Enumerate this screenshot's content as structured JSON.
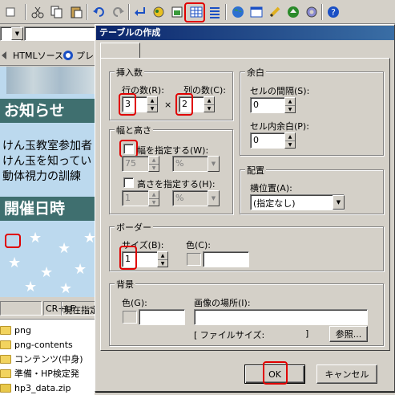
{
  "toolbar": {
    "icons": [
      "cut-icon",
      "copy-icon",
      "paste-icon",
      "undo-icon",
      "redo-icon",
      "line-break-icon",
      "picture-icon",
      "image-insert-icon",
      "table-icon",
      "list-icon",
      "globe-icon",
      "window-icon",
      "pencil-icon",
      "ball-icon",
      "gear-icon",
      "help-icon"
    ],
    "accent": "#e00000"
  },
  "editor": {
    "view_tabs": [
      "HTMLソース",
      "プレ"
    ],
    "heading1": "お知らせ",
    "lines": [
      "けん玉教室参加者",
      "けん玉を知ってい",
      "動体視力の訓練"
    ],
    "heading2": "開催日時",
    "heading_bg": "#3f6f6f",
    "page_bg": "#bcd9ee"
  },
  "statusbar": {
    "newline": "CR+LF",
    "cursor": "現在指定"
  },
  "file_list": [
    "png",
    "png-contents",
    "コンテンツ(中身)",
    "準備・HP検定発",
    "hp3_data.zip"
  ],
  "dialog": {
    "title": "テーブルの作成",
    "insert": {
      "label": "挿入数",
      "rows_label": "行の数(R):",
      "rows_value": "3",
      "cols_label": "列の数(C):",
      "cols_value": "2",
      "times": "×"
    },
    "margin": {
      "label": "余白",
      "spacing_label": "セルの間隔(S):",
      "spacing_value": "0",
      "padding_label": "セル内余白(P):",
      "padding_value": "0"
    },
    "size": {
      "label": "幅と高さ",
      "width_label": "幅を指定する(W):",
      "width_value": "75",
      "width_unit": "%",
      "height_label": "高さを指定する(H):",
      "height_value": "1",
      "height_unit": "%"
    },
    "align": {
      "label": "配置",
      "halign_label": "横位置(A):",
      "halign_value": "(指定なし)"
    },
    "border": {
      "label": "ボーダー",
      "size_label": "サイズ(B):",
      "size_value": "1",
      "color_label": "色(C):"
    },
    "background": {
      "label": "背景",
      "color_label": "色(G):",
      "image_label": "画像の場所(I):",
      "filesize_label": "[ ファイルサイズ:",
      "filesize_close": "]",
      "browse_label": "参照..."
    },
    "ok_label": "OK",
    "cancel_label": "キャンセル"
  }
}
